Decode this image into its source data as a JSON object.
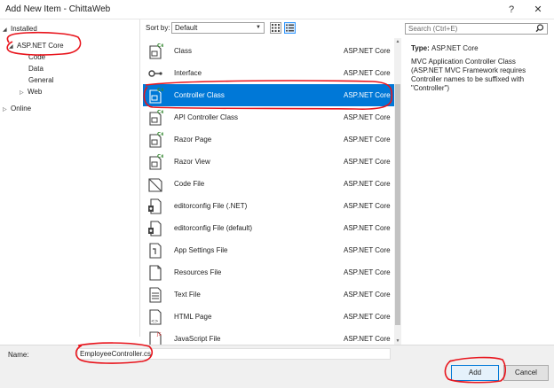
{
  "window": {
    "title": "Add New Item - ChittaWeb",
    "help_label": "?",
    "close_label": "✕"
  },
  "sidebar": {
    "installed_label": "Installed",
    "items": [
      {
        "label": "ASP.NET Core"
      },
      {
        "label": "Code"
      },
      {
        "label": "Data"
      },
      {
        "label": "General"
      },
      {
        "label": "Web"
      }
    ],
    "online_label": "Online"
  },
  "toolbar": {
    "sort_label": "Sort by:",
    "sort_value": "Default"
  },
  "templates": [
    {
      "name": "Class",
      "tag": "ASP.NET Core",
      "icon": "class-icon"
    },
    {
      "name": "Interface",
      "tag": "ASP.NET Core",
      "icon": "interface-icon"
    },
    {
      "name": "Controller Class",
      "tag": "ASP.NET Core",
      "icon": "controller-class-icon",
      "selected": true
    },
    {
      "name": "API Controller Class",
      "tag": "ASP.NET Core",
      "icon": "api-controller-icon"
    },
    {
      "name": "Razor Page",
      "tag": "ASP.NET Core",
      "icon": "razor-page-icon"
    },
    {
      "name": "Razor View",
      "tag": "ASP.NET Core",
      "icon": "razor-view-icon"
    },
    {
      "name": "Code File",
      "tag": "ASP.NET Core",
      "icon": "code-file-icon"
    },
    {
      "name": "editorconfig File (.NET)",
      "tag": "ASP.NET Core",
      "icon": "editorconfig-icon"
    },
    {
      "name": "editorconfig File (default)",
      "tag": "ASP.NET Core",
      "icon": "editorconfig-default-icon"
    },
    {
      "name": "App Settings File",
      "tag": "ASP.NET Core",
      "icon": "app-settings-icon"
    },
    {
      "name": "Resources File",
      "tag": "ASP.NET Core",
      "icon": "resources-file-icon"
    },
    {
      "name": "Text File",
      "tag": "ASP.NET Core",
      "icon": "text-file-icon"
    },
    {
      "name": "HTML Page",
      "tag": "ASP.NET Core",
      "icon": "html-page-icon"
    },
    {
      "name": "JavaScript File",
      "tag": "ASP.NET Core",
      "icon": "javascript-file-icon"
    }
  ],
  "details": {
    "search_placeholder": "Search (Ctrl+E)",
    "type_label": "Type:",
    "type_value": "ASP.NET Core",
    "description": "MVC Application Controller Class (ASP.NET MVC Framework requires Controller names to be suffixed with \"Controller\")"
  },
  "footer": {
    "name_label": "Name:",
    "name_value": "EmployeeController.cs",
    "add_label": "Add",
    "cancel_label": "Cancel"
  },
  "colors": {
    "selection": "#0078d7",
    "annotation": "#e8141c"
  }
}
